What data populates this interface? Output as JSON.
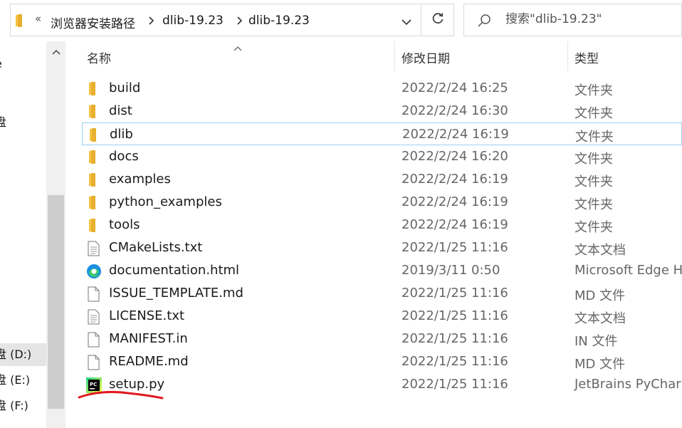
{
  "address": {
    "overflow_glyph": "«",
    "crumbs": [
      "浏览器安装路径",
      "dlib-19.23",
      "dlib-19.23"
    ]
  },
  "search": {
    "placeholder": "搜索\"dlib-19.23\""
  },
  "nav": {
    "items": [
      {
        "label": "e"
      },
      {
        "label": "盘"
      },
      {
        "label": "盘 (D:)",
        "selected": true
      },
      {
        "label": "盘 (E:)"
      },
      {
        "label": "盘 (F:)"
      }
    ]
  },
  "columns": {
    "name": "名称",
    "date": "修改日期",
    "type": "类型"
  },
  "files": [
    {
      "name": "build",
      "date": "2022/2/24 16:25",
      "type": "文件夹",
      "icon": "folder-icon"
    },
    {
      "name": "dist",
      "date": "2022/2/24 16:30",
      "type": "文件夹",
      "icon": "folder-icon"
    },
    {
      "name": "dlib",
      "date": "2022/2/24 16:19",
      "type": "文件夹",
      "icon": "folder-icon"
    },
    {
      "name": "docs",
      "date": "2022/2/24 16:20",
      "type": "文件夹",
      "icon": "folder-icon"
    },
    {
      "name": "examples",
      "date": "2022/2/24 16:19",
      "type": "文件夹",
      "icon": "folder-icon"
    },
    {
      "name": "python_examples",
      "date": "2022/2/24 16:19",
      "type": "文件夹",
      "icon": "folder-icon"
    },
    {
      "name": "tools",
      "date": "2022/2/24 16:19",
      "type": "文件夹",
      "icon": "folder-icon"
    },
    {
      "name": "CMakeLists.txt",
      "date": "2022/1/25 11:16",
      "type": "文本文档",
      "icon": "text-file-icon"
    },
    {
      "name": "documentation.html",
      "date": "2019/3/11 0:50",
      "type": "Microsoft Edge HTML",
      "icon": "edge-icon"
    },
    {
      "name": "ISSUE_TEMPLATE.md",
      "date": "2022/1/25 11:16",
      "type": "MD 文件",
      "icon": "file-icon"
    },
    {
      "name": "LICENSE.txt",
      "date": "2022/1/25 11:16",
      "type": "文本文档",
      "icon": "text-file-icon"
    },
    {
      "name": "MANIFEST.in",
      "date": "2022/1/25 11:16",
      "type": "IN 文件",
      "icon": "file-icon"
    },
    {
      "name": "README.md",
      "date": "2022/1/25 11:16",
      "type": "MD 文件",
      "icon": "file-icon"
    },
    {
      "name": "setup.py",
      "date": "2022/1/25 11:16",
      "type": "JetBrains PyCharm",
      "icon": "pycharm-icon"
    }
  ],
  "focused_row": "dlib",
  "annotation": {
    "color": "#e0191e"
  },
  "colors": {
    "folder": "#f5c342",
    "focus_border": "#9ad0f5",
    "selected_bg": "#e5e5e5"
  },
  "icons": [
    "folder-icon",
    "chevron-right-icon",
    "chevron-down-icon",
    "refresh-icon",
    "search-icon",
    "sort-up-arrow-icon",
    "text-file-icon",
    "file-icon",
    "edge-icon",
    "pycharm-icon"
  ]
}
